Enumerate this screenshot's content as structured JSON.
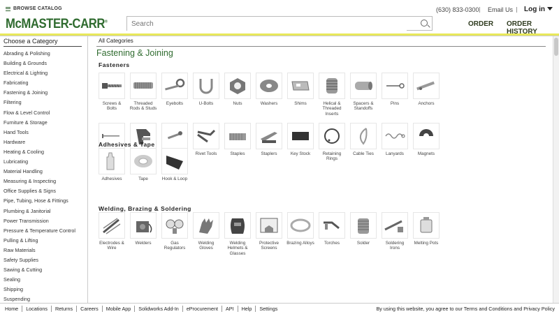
{
  "header": {
    "browse_label": "BROWSE CATALOG",
    "logo": "McMASTER-CARR",
    "search_placeholder": "Search",
    "phone": "(630) 833-0300",
    "email": "Email Us",
    "login": "Log in",
    "order": "ORDER",
    "order_history": "ORDER HISTORY",
    "accent_color": "#e8e85a",
    "brand_color": "#2f6b2f"
  },
  "sidebar": {
    "title": "Choose a Category",
    "items": [
      "Abrading & Polishing",
      "Building & Grounds",
      "Electrical & Lighting",
      "Fabricating",
      "Fastening & Joining",
      "Filtering",
      "Flow & Level Control",
      "Furniture & Storage",
      "Hand Tools",
      "Hardware",
      "Heating & Cooling",
      "Lubricating",
      "Material Handling",
      "Measuring & Inspecting",
      "Office Supplies & Signs",
      "Pipe, Tubing, Hose & Fittings",
      "Plumbing & Janitorial",
      "Power Transmission",
      "Pressure & Temperature Control",
      "Pulling & Lifting",
      "Raw Materials",
      "Safety Supplies",
      "Sawing & Cutting",
      "Sealing",
      "Shipping",
      "Suspending"
    ]
  },
  "main": {
    "breadcrumb": "All Categories",
    "title": "Fastening & Joining",
    "sections": [
      {
        "title": "Fasteners",
        "tiles": [
          {
            "label": "Screws & Bolts",
            "icon": "screw-icon"
          },
          {
            "label": "Threaded Rods & Studs",
            "icon": "threaded-rod-icon"
          },
          {
            "label": "Eyebolts",
            "icon": "eyebolt-icon"
          },
          {
            "label": "U-Bolts",
            "icon": "u-bolt-icon"
          },
          {
            "label": "Nuts",
            "icon": "nut-icon"
          },
          {
            "label": "Washers",
            "icon": "washer-icon"
          },
          {
            "label": "Shims",
            "icon": "shim-icon"
          },
          {
            "label": "Helical & Threaded Inserts",
            "icon": "helical-insert-icon"
          },
          {
            "label": "Spacers & Standoffs",
            "icon": "spacer-icon"
          },
          {
            "label": "Pins",
            "icon": "pin-icon"
          },
          {
            "label": "Anchors",
            "icon": "anchor-icon"
          },
          {
            "label": "Nails",
            "icon": "nail-icon"
          },
          {
            "label": "Nailers",
            "icon": "nailer-icon"
          },
          {
            "label": "Rivets",
            "icon": "rivet-icon"
          },
          {
            "label": "Rivet Tools",
            "icon": "rivet-tool-icon"
          },
          {
            "label": "Staples",
            "icon": "staples-icon"
          },
          {
            "label": "Staplers",
            "icon": "stapler-icon"
          },
          {
            "label": "Key Stock",
            "icon": "key-stock-icon"
          },
          {
            "label": "Retaining Rings",
            "icon": "retaining-ring-icon"
          },
          {
            "label": "Cable Ties",
            "icon": "cable-tie-icon"
          },
          {
            "label": "Lanyards",
            "icon": "lanyard-icon"
          },
          {
            "label": "Magnets",
            "icon": "magnet-icon"
          }
        ]
      },
      {
        "title": "Adhesives & Tape",
        "tiles": [
          {
            "label": "Adhesives",
            "icon": "adhesive-icon"
          },
          {
            "label": "Tape",
            "icon": "tape-icon"
          },
          {
            "label": "Hook & Loop",
            "icon": "hook-loop-icon"
          }
        ]
      },
      {
        "title": "Welding, Brazing & Soldering",
        "tiles": [
          {
            "label": "Electrodes & Wire",
            "icon": "electrode-icon"
          },
          {
            "label": "Welders",
            "icon": "welder-icon"
          },
          {
            "label": "Gas Regulators",
            "icon": "gas-regulator-icon"
          },
          {
            "label": "Welding Gloves",
            "icon": "glove-icon"
          },
          {
            "label": "Welding Helmets & Glasses",
            "icon": "helmet-icon"
          },
          {
            "label": "Protective Screens",
            "icon": "screen-icon"
          },
          {
            "label": "Brazing Alloys",
            "icon": "brazing-alloy-icon"
          },
          {
            "label": "Torches",
            "icon": "torch-icon"
          },
          {
            "label": "Solder",
            "icon": "solder-icon"
          },
          {
            "label": "Soldering Irons",
            "icon": "soldering-iron-icon"
          },
          {
            "label": "Melting Pots",
            "icon": "melting-pot-icon"
          }
        ]
      }
    ]
  },
  "footer": {
    "links": [
      "Home",
      "Locations",
      "Returns",
      "Careers",
      "Mobile App",
      "Solidworks Add-In",
      "eProcurement",
      "API",
      "Help",
      "Settings"
    ],
    "notice": "By using this website, you agree to our Terms and Conditions and Privacy Policy"
  }
}
